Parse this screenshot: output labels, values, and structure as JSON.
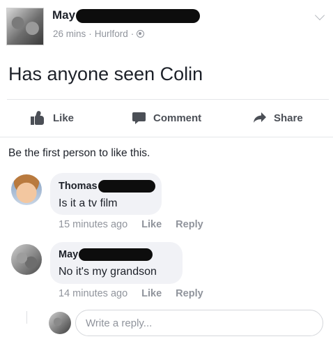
{
  "post": {
    "author": "May",
    "time": "26 mins",
    "separator": "·",
    "location": "Hurlford",
    "text": "Has anyone seen Colin"
  },
  "actions": {
    "like": "Like",
    "comment": "Comment",
    "share": "Share"
  },
  "likes_summary": "Be the first person to like this.",
  "comments": [
    {
      "author": "Thomas",
      "text": "Is it a tv film",
      "time": "15 minutes ago",
      "like": "Like",
      "reply": "Reply"
    },
    {
      "author": "May",
      "text": "No it's my grandson",
      "time": "14 minutes ago",
      "like": "Like",
      "reply": "Reply"
    }
  ],
  "reply": {
    "placeholder": "Write a reply..."
  },
  "colors": {
    "text": "#1d2129",
    "meta": "#90949c",
    "action": "#4b4f56",
    "bubble": "#f1f2f6",
    "redaction": "#0d0d0d"
  }
}
